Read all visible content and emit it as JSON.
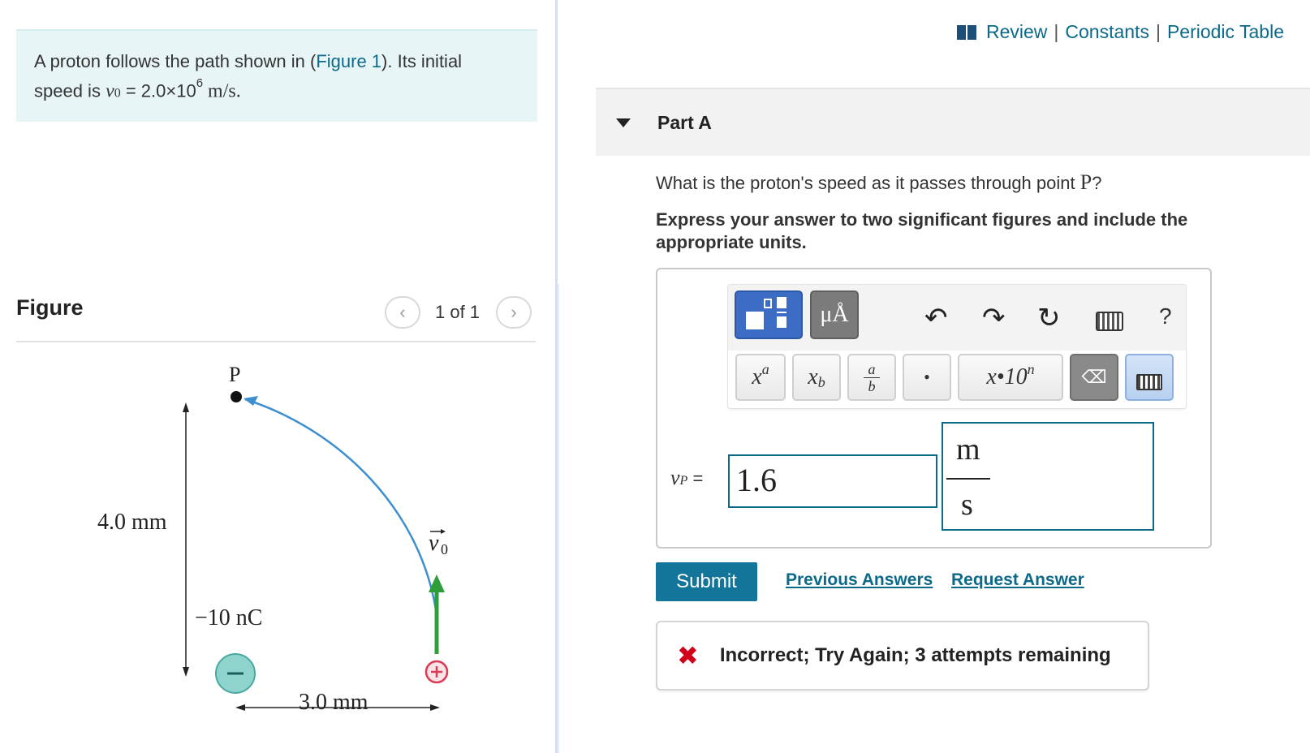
{
  "problem": {
    "text_before": "A proton follows the path shown in (",
    "figure_link": "Figure 1",
    "text_after": "). Its initial",
    "line2_prefix": "speed is ",
    "v0_symbol": "v",
    "v0_sub": "0",
    "equals": " = 2.0×10",
    "exponent": "6",
    "unit": " m/s."
  },
  "figure": {
    "title": "Figure",
    "counter": "1 of 1",
    "prev_icon": "chevron-left-icon",
    "next_icon": "chevron-right-icon",
    "labels": {
      "point": "P",
      "height": "4.0 mm",
      "charge": "−10 nC",
      "width": "3.0 mm",
      "velocity": "v",
      "velocity_sub": "0"
    },
    "colors": {
      "path": "#3d8fd0",
      "velocity_arrow": "#2e9e3a",
      "negative_charge_fill": "#8fd3cd",
      "negative_charge_stroke": "#4aa9a0",
      "positive_charge": "#d93a54"
    }
  },
  "header": {
    "links": [
      "Review",
      "Constants",
      "Periodic Table"
    ],
    "book_icon": "book-icon"
  },
  "part": {
    "title": "Part A",
    "question_prefix": "What is the proton's speed as it passes through point ",
    "question_point": "P",
    "question_suffix": "?",
    "instructions": "Express your answer to two significant figures and include the appropriate units."
  },
  "toolbar": {
    "units_label": "μÅ",
    "keys": {
      "superscript_base": "x",
      "superscript_exp": "a",
      "subscript_base": "x",
      "subscript_sub": "b",
      "fraction_num": "a",
      "fraction_den": "b",
      "dot": "•",
      "sci": "x•10",
      "sci_exp": "n"
    },
    "help": "?"
  },
  "answer": {
    "label_symbol": "v",
    "label_sub": "P",
    "label_eq": " =",
    "value": "1.6",
    "unit_numerator": "m",
    "unit_denominator": "s"
  },
  "actions": {
    "submit": "Submit",
    "previous_answers": "Previous Answers",
    "request_answer": "Request Answer"
  },
  "feedback": {
    "icon": "x-mark-icon",
    "text": "Incorrect; Try Again; 3 attempts remaining",
    "color": "#d0021b"
  },
  "theme": {
    "link": "#0b6a8a",
    "submit_bg": "#13759a",
    "problem_bg": "#e8f5f7"
  }
}
